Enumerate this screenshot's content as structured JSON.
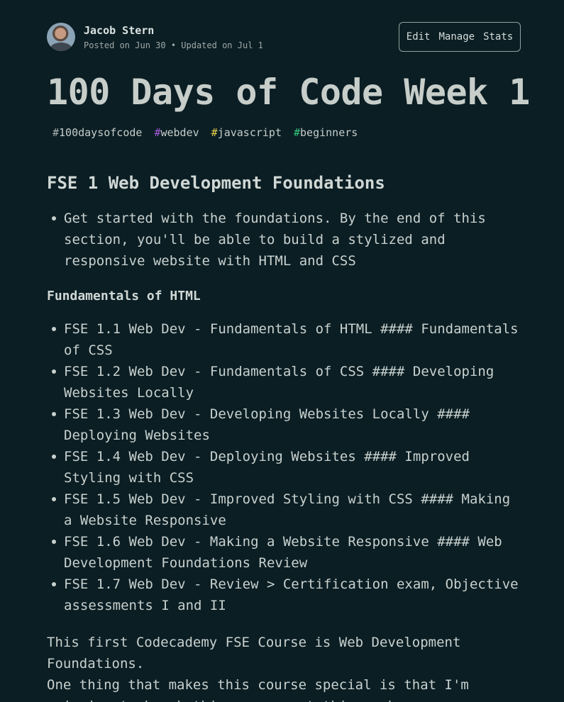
{
  "author": {
    "name": "Jacob Stern",
    "meta": "Posted on Jun 30 • Updated on Jul 1"
  },
  "actions": {
    "edit_label": "Edit",
    "manage_label": "Manage",
    "stats_label": "Stats"
  },
  "article": {
    "title": "100 Days of Code Week 1",
    "tags": [
      {
        "hash": "#",
        "text": "100daysofcode",
        "color": "#a8b1af"
      },
      {
        "hash": "#",
        "text": "webdev",
        "color": "#a55bd6"
      },
      {
        "hash": "#",
        "text": "javascript",
        "color": "#e8d04a"
      },
      {
        "hash": "#",
        "text": "beginners",
        "color": "#34c77b"
      }
    ],
    "section_heading": "FSE 1 Web Development Foundations",
    "intro_list": [
      "Get started with the foundations. By the end of this section, you'll be able to build a stylized and responsive website with HTML and CSS"
    ],
    "sub_heading": "Fundamentals of HTML",
    "course_list": [
      "FSE 1.1 Web Dev - Fundamentals of HTML #### Fundamentals of CSS",
      "FSE 1.2 Web Dev - Fundamentals of CSS #### Developing Websites Locally",
      "FSE 1.3 Web Dev - Developing Websites Locally #### Deploying Websites",
      "FSE 1.4 Web Dev - Deploying Websites #### Improved Styling with CSS",
      "FSE 1.5 Web Dev - Improved Styling with CSS #### Making a Website Responsive",
      "FSE 1.6 Web Dev - Making a Website Responsive #### Web Development Foundations Review",
      "FSE 1.7 Web Dev - Review > Certification exam, Objective assessments I and II"
    ],
    "paragraph_1": "This first Codecademy FSE Course is Web Development Foundations.",
    "paragraph_2": "One thing that makes this course special is that I'm swinging to knock this course out this week."
  }
}
